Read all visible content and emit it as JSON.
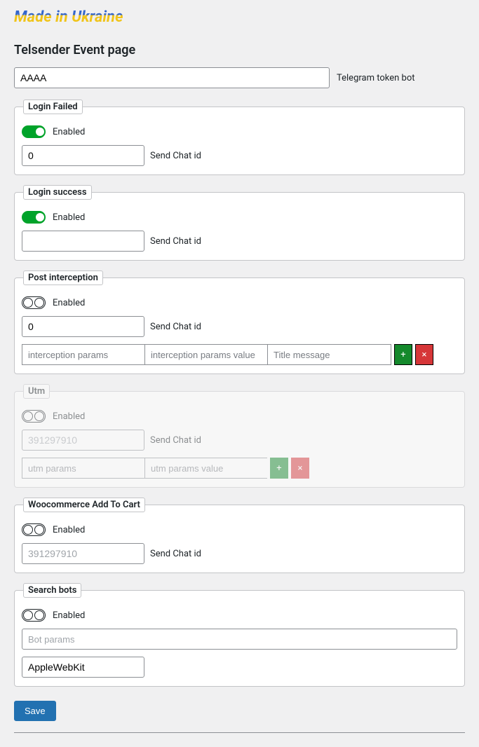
{
  "banner": "Made in Ukraine",
  "page_title": "Telsender Event page",
  "token": {
    "value": "AAAA",
    "label": "Telegram token bot"
  },
  "sections": {
    "login_failed": {
      "legend": "Login Failed",
      "enabled_label": "Enabled",
      "enabled": true,
      "chat_id_value": "0",
      "chat_id_label": "Send Chat id"
    },
    "login_success": {
      "legend": "Login success",
      "enabled_label": "Enabled",
      "enabled": true,
      "chat_id_value": "",
      "chat_id_label": "Send Chat id"
    },
    "post_interception": {
      "legend": "Post interception",
      "enabled_label": "Enabled",
      "enabled": false,
      "chat_id_value": "0",
      "chat_id_label": "Send Chat id",
      "param_placeholder": "interception params",
      "param_value_placeholder": "interception params value",
      "title_placeholder": "Title message",
      "add_label": "+",
      "remove_label": "×"
    },
    "utm": {
      "legend": "Utm",
      "enabled_label": "Enabled",
      "enabled": false,
      "chat_id_placeholder": "391297910",
      "chat_id_label": "Send Chat id",
      "param_placeholder": "utm params",
      "param_value_placeholder": "utm params value",
      "add_label": "+",
      "remove_label": "×"
    },
    "woo_add_to_cart": {
      "legend": "Woocommerce Add To Cart",
      "enabled_label": "Enabled",
      "enabled": false,
      "chat_id_placeholder": "391297910",
      "chat_id_label": "Send Chat id"
    },
    "search_bots": {
      "legend": "Search bots",
      "enabled_label": "Enabled",
      "enabled": false,
      "bot_params_placeholder": "Bot params",
      "bot_value": "AppleWebKit"
    }
  },
  "save_label": "Save"
}
